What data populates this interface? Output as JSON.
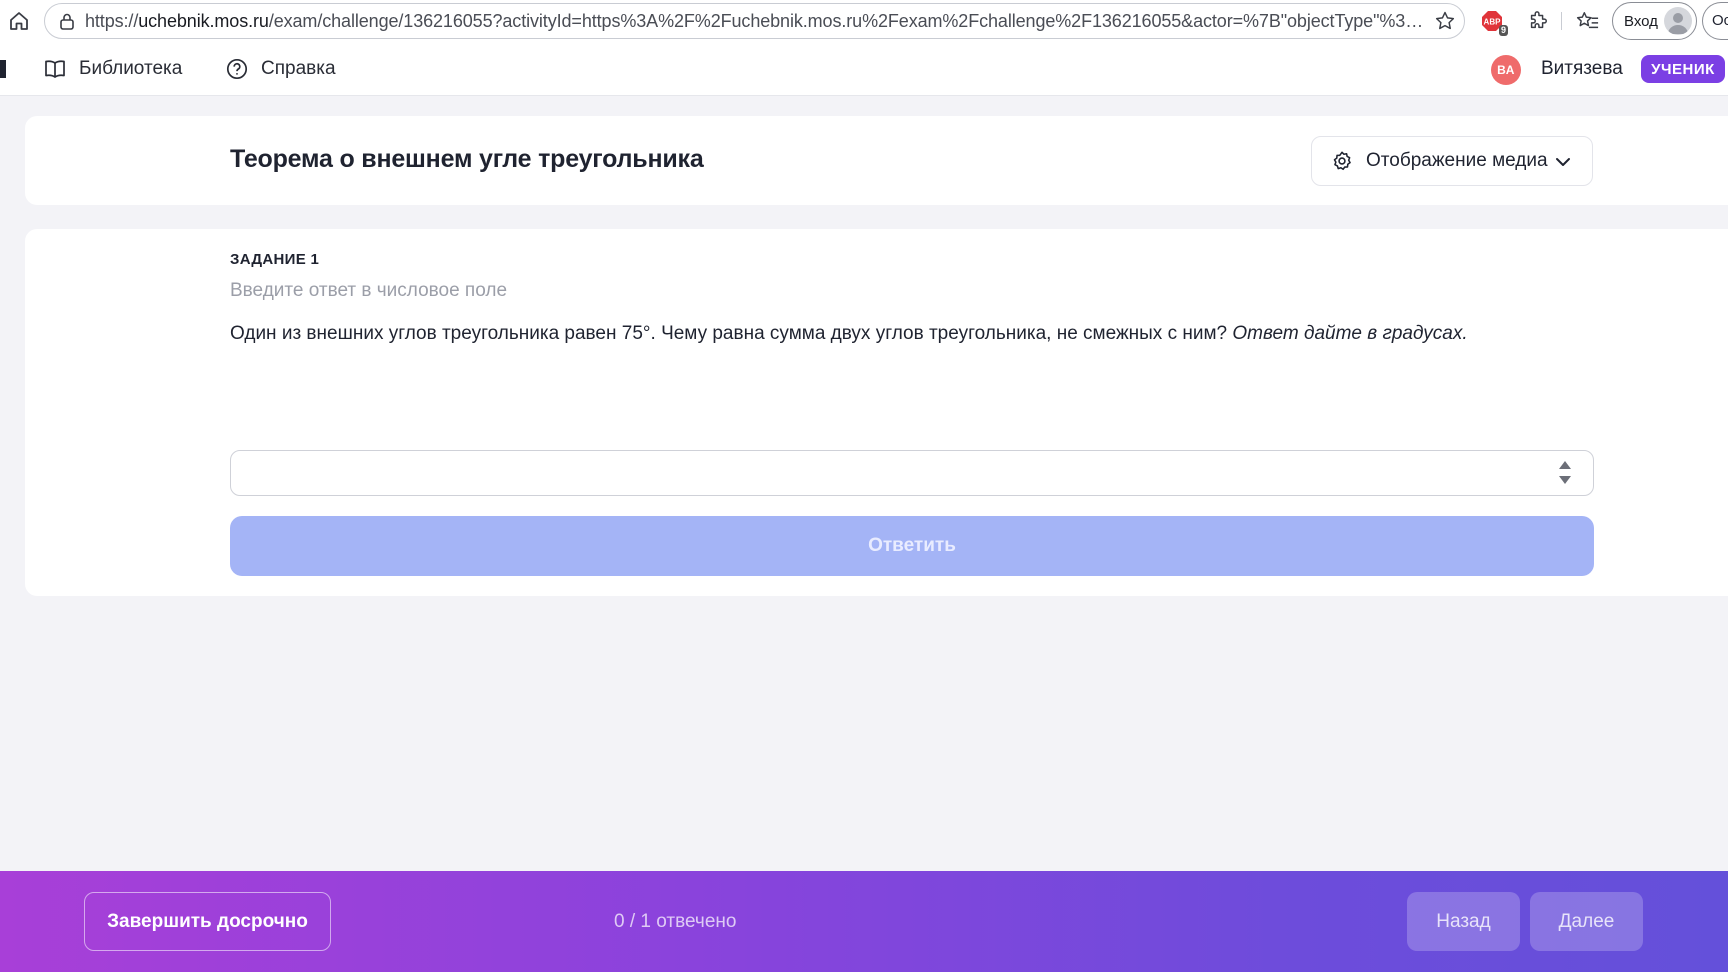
{
  "browser": {
    "url_prefix": "https://",
    "url_host": "uchebnik.mos.ru",
    "url_rest": "/exam/challenge/136216055?activityId=https%3A%2F%2Fuchebnik.mos.ru%2Fexam%2Fchallenge%2F136216055&actor=%7B\"objectType\"%3A\"Ag...",
    "abp_badge": "9",
    "signin_label": "Вход",
    "extra_tab_label": "Oc"
  },
  "nav": {
    "library_label": "Библиотека",
    "help_label": "Справка",
    "user_initials": "ВА",
    "user_name": "Витязева",
    "role_badge": "УЧЕНИК"
  },
  "header": {
    "title": "Теорема о внешнем угле треугольника",
    "media_button_label": "Отображение медиа"
  },
  "task": {
    "label": "ЗАДАНИЕ 1",
    "hint": "Введите ответ в числовое поле",
    "question": "Один из внешних углов треугольника равен 75°. Чему равна сумма двух углов треугольника, не смежных с ним? ",
    "question_emphasis": "Ответ дайте в градусах.",
    "answer_value": "",
    "submit_label": "Ответить"
  },
  "footer": {
    "finish_label": "Завершить досрочно",
    "progress": "0 / 1 отвечено",
    "back_label": "Назад",
    "next_label": "Далее"
  },
  "colors": {
    "accent_purple": "#7b3fe4",
    "submit_disabled": "#a4b4f6",
    "avatar_red": "#ef6b6b",
    "footer_gradient_start": "#a83fd8",
    "footer_gradient_end": "#6450da"
  }
}
